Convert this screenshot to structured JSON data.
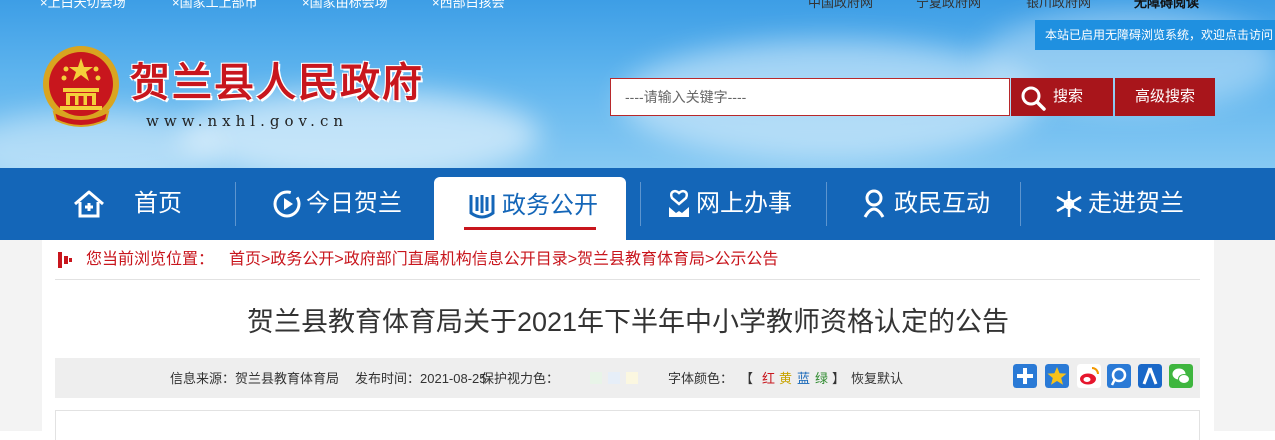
{
  "top_links": {
    "left": [
      "×上白天切会场",
      "×国家工上部币",
      "×国家由标会场",
      "×西部白孩会"
    ],
    "right": [
      "中国政府网",
      "宁夏政府网",
      "银川政府网",
      "无障碍阅读"
    ]
  },
  "notice_text": "本站已启用无障碍浏览系统，欢迎点击访问",
  "site": {
    "title": "贺兰县人民政府",
    "url": "www.nxhl.gov.cn"
  },
  "search": {
    "placeholder": "----请输入关键字----",
    "button": "搜索",
    "advanced": "高级搜索"
  },
  "nav": [
    {
      "label": "首页",
      "icon": "home-icon"
    },
    {
      "label": "今日贺兰",
      "icon": "play-circle-icon"
    },
    {
      "label": "政务公开",
      "icon": "open-book-icon",
      "active": true
    },
    {
      "label": "网上办事",
      "icon": "handshake-icon"
    },
    {
      "label": "政民互动",
      "icon": "person-icon"
    },
    {
      "label": "走进贺兰",
      "icon": "snowflake-icon"
    }
  ],
  "breadcrumb": {
    "label": "您当前浏览位置：",
    "path": "首页>政务公开>政府部门直属机构信息公开目录>贺兰县教育体育局>公示公告"
  },
  "article": {
    "title": "贺兰县教育体育局关于2021年下半年中小学教师资格认定的公告"
  },
  "meta": {
    "source": "信息来源：贺兰县教育体育局",
    "published": "发布时间：2021-08-25",
    "eye_protect_label": "保护视力色：",
    "eye_protect_colors": [
      "#e8f4e8",
      "#e6eef8",
      "#fbf7e0"
    ],
    "font_color_label": "字体颜色：",
    "font_colors": [
      {
        "label": "红",
        "color": "#c8161d"
      },
      {
        "label": "黄",
        "color": "#c8a400"
      },
      {
        "label": "蓝",
        "color": "#1466b8"
      },
      {
        "label": "绿",
        "color": "#2e8b2e"
      }
    ],
    "bracket_open": "【",
    "bracket_close": "】",
    "reset": "恢复默认"
  },
  "share_icons": [
    "add-share-icon",
    "qzone-icon",
    "weibo-icon",
    "tencent-weibo-icon",
    "renren-icon",
    "wechat-icon"
  ],
  "colors": {
    "brand_red": "#c8161d",
    "nav_blue": "#1466b8",
    "button_red": "#a8151b"
  }
}
